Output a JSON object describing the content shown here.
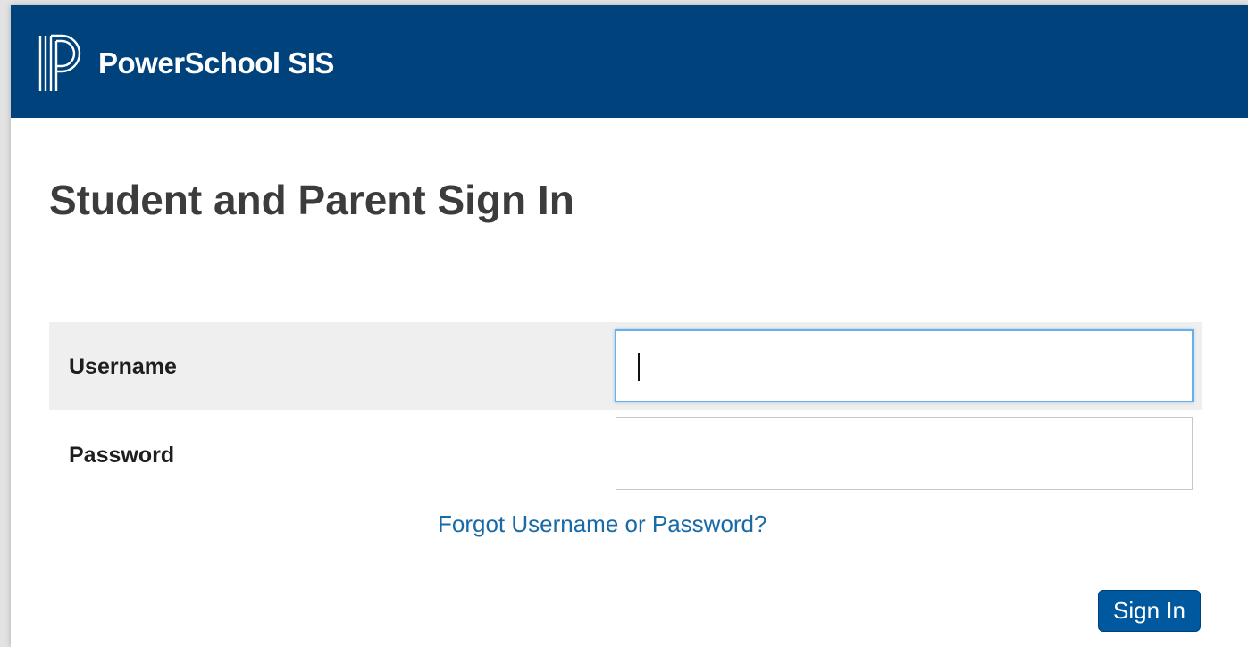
{
  "header": {
    "brand_name": "PowerSchool SIS",
    "logo_icon": "powerschool-p-logo",
    "background_color": "#00427c"
  },
  "main": {
    "title": "Student and Parent Sign In"
  },
  "form": {
    "username_label": "Username",
    "username_value": "",
    "password_label": "Password",
    "password_value": "",
    "forgot_link": "Forgot Username or Password?",
    "submit_label": "Sign In",
    "submit_color": "#00589f",
    "link_color": "#1a6aa6"
  }
}
